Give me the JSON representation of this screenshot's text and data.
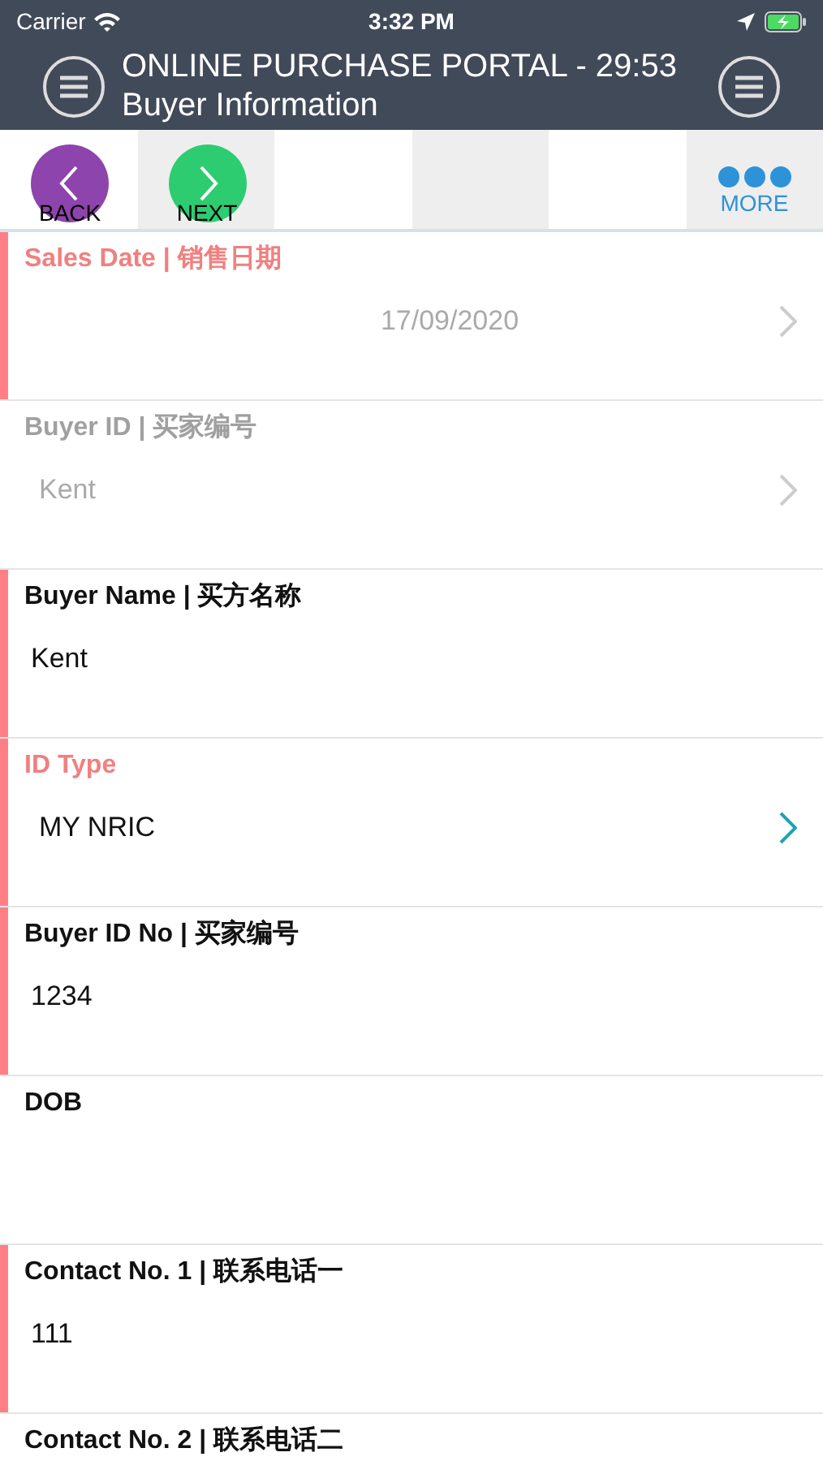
{
  "status_bar": {
    "carrier": "Carrier",
    "time": "3:32 PM"
  },
  "header": {
    "title": "ONLINE PURCHASE PORTAL - 29:53",
    "subtitle": "Buyer Information"
  },
  "toolbar": [
    {
      "kind": "back",
      "label": "BACK"
    },
    {
      "kind": "next",
      "label": "NEXT"
    },
    {
      "kind": "empty"
    },
    {
      "kind": "empty"
    },
    {
      "kind": "empty"
    },
    {
      "kind": "more",
      "label": "MORE"
    }
  ],
  "fields": [
    {
      "kind": "date",
      "label": "Sales Date | 销售日期",
      "required": true,
      "invalid": true,
      "disabled": false,
      "value": "17/09/2020"
    },
    {
      "kind": "picker",
      "label": "Buyer ID |  买家编号",
      "required": false,
      "invalid": false,
      "disabled": true,
      "value": "Kent"
    },
    {
      "kind": "text",
      "label": "Buyer Name | 买方名称",
      "required": true,
      "invalid": false,
      "disabled": false,
      "value": "Kent"
    },
    {
      "kind": "picker",
      "label": "ID Type",
      "required": true,
      "invalid": true,
      "disabled": false,
      "value": "MY NRIC"
    },
    {
      "kind": "text",
      "label": "Buyer ID No | 买家编号",
      "required": true,
      "invalid": false,
      "disabled": false,
      "value": "1234"
    },
    {
      "kind": "text",
      "label": "DOB",
      "required": false,
      "invalid": false,
      "disabled": false
    },
    {
      "kind": "text",
      "label": "Contact No. 1 | 联系电话一",
      "required": true,
      "invalid": false,
      "disabled": false,
      "value": "111"
    },
    {
      "kind": "text",
      "label": "Contact No. 2 | 联系电话二",
      "required": false,
      "invalid": false,
      "disabled": false
    }
  ]
}
